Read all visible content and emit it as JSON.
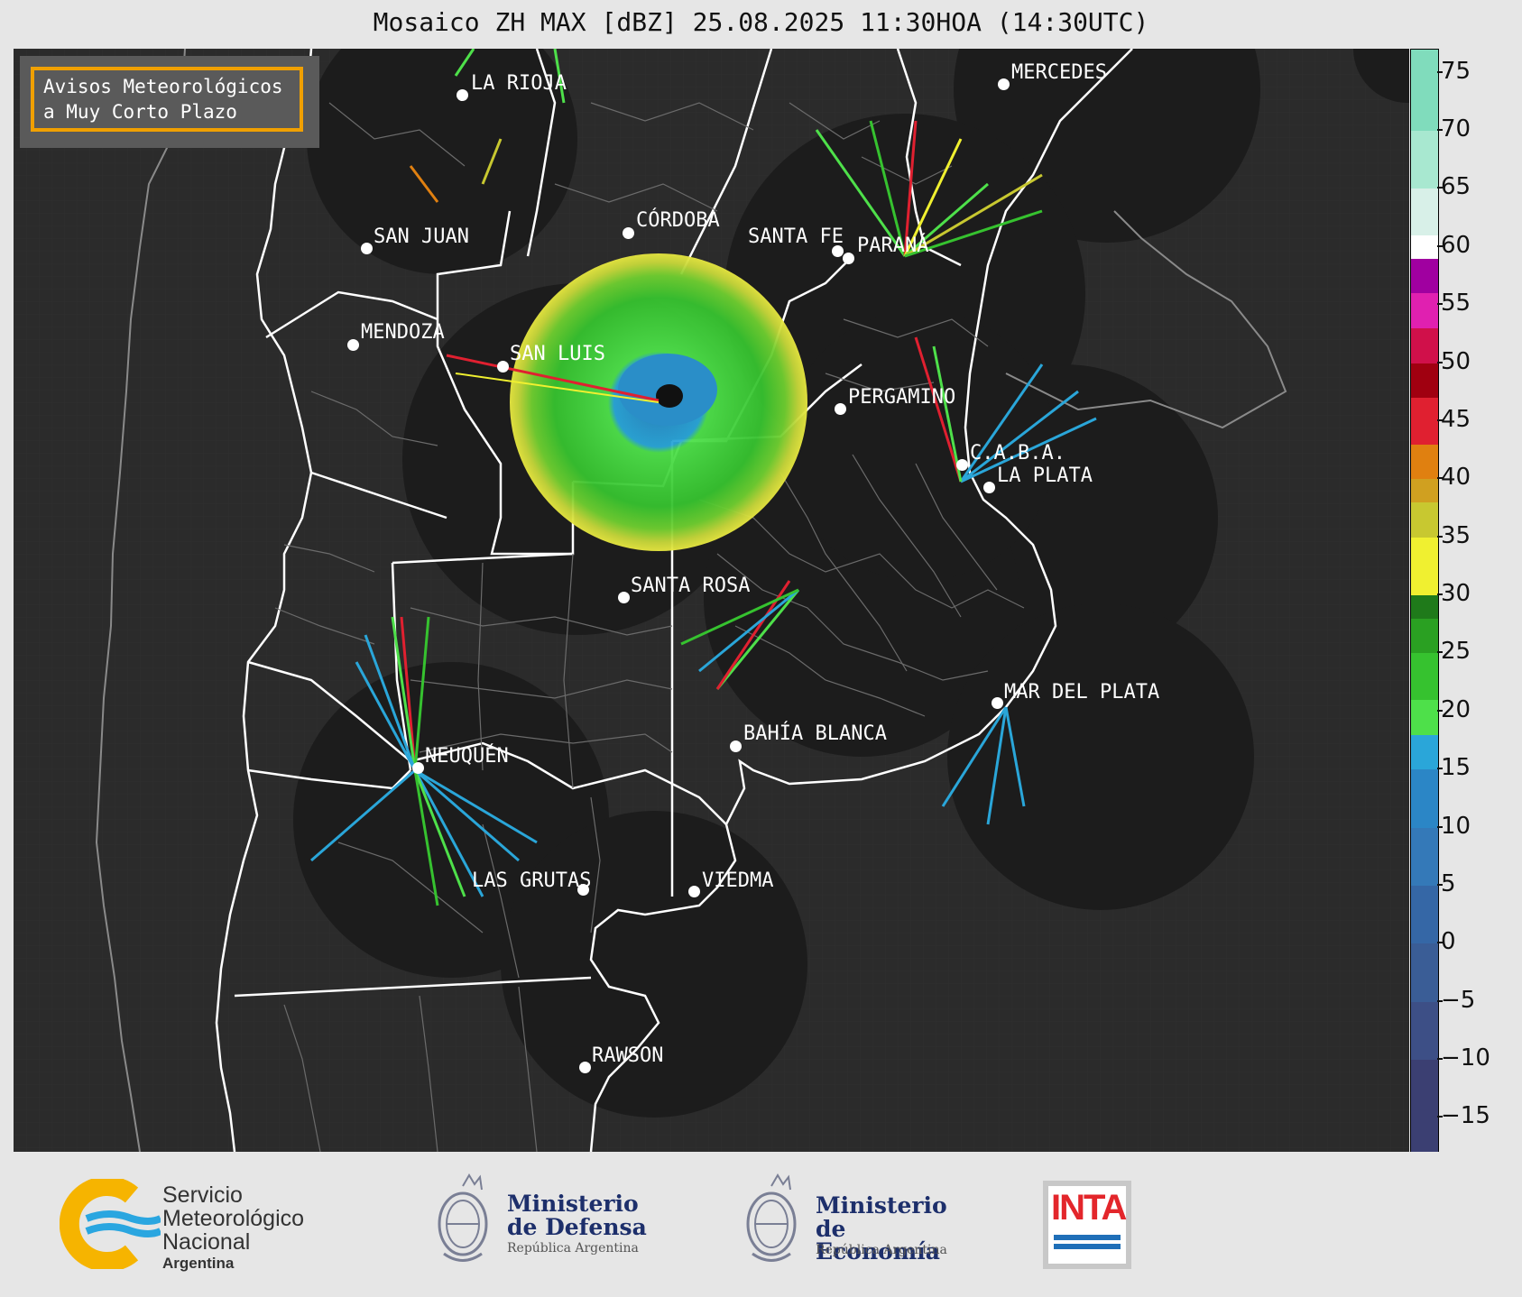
{
  "title": "Mosaico ZH MAX [dBZ] 25.08.2025 11:30HOA (14:30UTC)",
  "notice": {
    "line1": "Avisos Meteorológicos",
    "line2": "a Muy Corto Plazo"
  },
  "cities": [
    {
      "name": "LA RIOJA"
    },
    {
      "name": "MERCEDES"
    },
    {
      "name": "CÓRDOBA"
    },
    {
      "name": "SAN JUAN"
    },
    {
      "name": "SANTA FE"
    },
    {
      "name": "PARANÁ"
    },
    {
      "name": "MENDOZA"
    },
    {
      "name": "SAN LUIS"
    },
    {
      "name": "PERGAMINO"
    },
    {
      "name": "C.A.B.A."
    },
    {
      "name": "LA PLATA"
    },
    {
      "name": "SANTA ROSA"
    },
    {
      "name": "MAR DEL PLATA"
    },
    {
      "name": "BAHÍA BLANCA"
    },
    {
      "name": "NEUQUÉN"
    },
    {
      "name": "LAS GRUTAS"
    },
    {
      "name": "VIEDMA"
    },
    {
      "name": "RAWSON"
    }
  ],
  "colorbar": {
    "unit": "dBZ",
    "range": [
      -18,
      77
    ],
    "ticks": [
      "75",
      "70",
      "65",
      "60",
      "55",
      "50",
      "45",
      "40",
      "35",
      "30",
      "25",
      "20",
      "15",
      "10",
      "5",
      "0",
      "−5",
      "−10",
      "−15"
    ],
    "stops": [
      {
        "from": -18,
        "color": "#3b3f72"
      },
      {
        "from": -10,
        "color": "#3d4f86"
      },
      {
        "from": -5,
        "color": "#3a5d96"
      },
      {
        "from": 0,
        "color": "#3567a6"
      },
      {
        "from": 5,
        "color": "#3479b8"
      },
      {
        "from": 10,
        "color": "#2b86c6"
      },
      {
        "from": 15,
        "color": "#2aa6d9"
      },
      {
        "from": 18,
        "color": "#4ee04a"
      },
      {
        "from": 21,
        "color": "#36c22f"
      },
      {
        "from": 25,
        "color": "#2aa022"
      },
      {
        "from": 28,
        "color": "#1f7a1a"
      },
      {
        "from": 30,
        "color": "#f0f030"
      },
      {
        "from": 35,
        "color": "#c8c830"
      },
      {
        "from": 38,
        "color": "#d0a020"
      },
      {
        "from": 40,
        "color": "#e08010"
      },
      {
        "from": 43,
        "color": "#e02030"
      },
      {
        "from": 47,
        "color": "#a00010"
      },
      {
        "from": 50,
        "color": "#d0104a"
      },
      {
        "from": 53,
        "color": "#e020b0"
      },
      {
        "from": 56,
        "color": "#a000a0"
      },
      {
        "from": 59,
        "color": "#ffffff"
      },
      {
        "from": 61,
        "color": "#d8f0e8"
      },
      {
        "from": 65,
        "color": "#a8e8d0"
      },
      {
        "from": 70,
        "color": "#80dcbc"
      }
    ]
  },
  "footer": {
    "smn": {
      "line1": "Servicio",
      "line2": "Meteorológico",
      "line3": "Nacional",
      "line4": "Argentina"
    },
    "defensa": {
      "line1": "Ministerio",
      "line2": "de Defensa",
      "line3": "República Argentina"
    },
    "economia": {
      "line1": "Ministerio",
      "line2": "de Economía",
      "line3": "República Argentina"
    },
    "inta": {
      "label": "INTA"
    }
  },
  "colors": {
    "map_bg": "#2a2a2a",
    "radar_coverage": "#1c1c1c",
    "boundary": "#ffffff",
    "notice_border": "#f0a000"
  }
}
